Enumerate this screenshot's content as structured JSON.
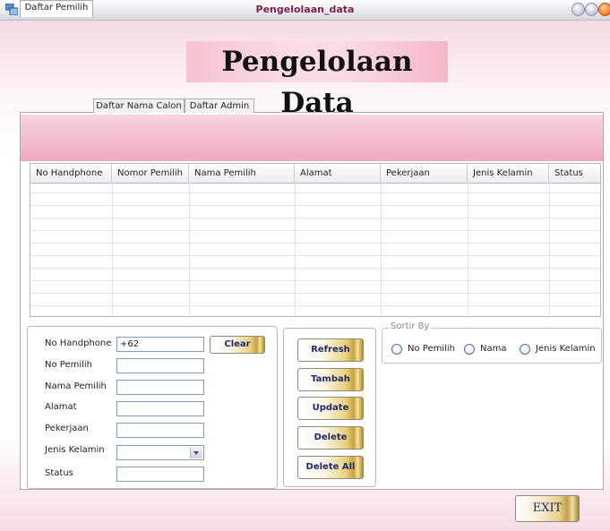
{
  "window": {
    "title": "Pengelolaan_data"
  },
  "heading": "Pengelolaan Data",
  "tabs": [
    {
      "label": "Daftar Pemilih",
      "active": true
    },
    {
      "label": "Daftar Nama Calon",
      "active": false
    },
    {
      "label": "Daftar Admin",
      "active": false
    }
  ],
  "table": {
    "columns": [
      "No Handphone",
      "Nomor Pemilih",
      "Nama Pemilih",
      "Alamat",
      "Pekerjaan",
      "Jenis Kelamin",
      "Status"
    ],
    "rows": []
  },
  "form": {
    "no_handphone_label": "No Handphone",
    "no_handphone_value": "+62",
    "no_pemilih_label": "No Pemilih",
    "nama_pemilih_label": "Nama Pemilih",
    "alamat_label": "Alamat",
    "pekerjaan_label": "Pekerjaan",
    "jenis_kelamin_label": "Jenis Kelamin",
    "status_label": "Status",
    "clear_label": "Clear"
  },
  "actions": {
    "refresh": "Refresh",
    "tambah": "Tambah",
    "update": "Update",
    "delete": "Delete",
    "delete_all": "Delete All"
  },
  "sort": {
    "title": "Sortir By",
    "options": [
      "No Pemilih",
      "Nama",
      "Jenis Kelamin"
    ]
  },
  "exit_label": "EXIT",
  "colors": {
    "accent_pink": "#efa9bf",
    "title_text": "#7a1f4f",
    "button_gold": "#c7a13c",
    "button_text": "#1d2a6b"
  }
}
